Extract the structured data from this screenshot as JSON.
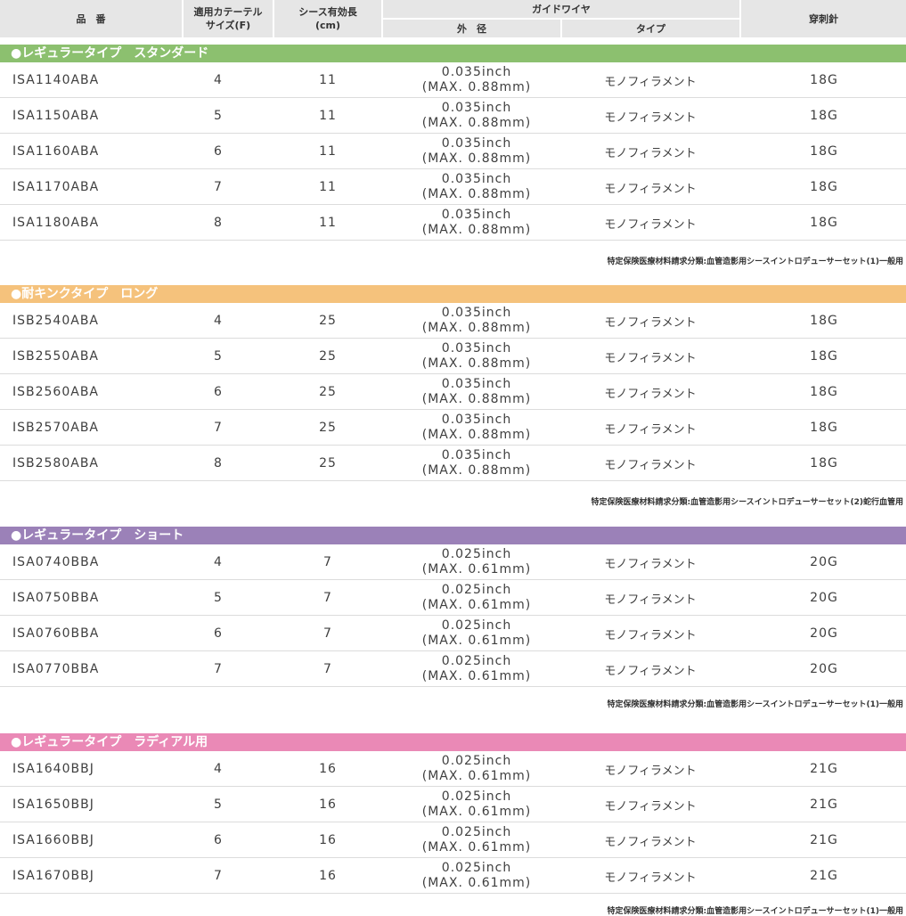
{
  "header": {
    "product_no": "品　番",
    "size_l1": "適用カテーテル",
    "size_l2": "サイズ(F)",
    "length_l1": "シース有効長",
    "length_l2": "(cm)",
    "guidewire": "ガイドワイヤ",
    "outer_diameter": "外　径",
    "type": "タイプ",
    "needle": "穿刺針"
  },
  "colors": {
    "header_bg": "#e6e6e6",
    "green": "#8cc06f",
    "orange": "#f5c27c",
    "purple": "#9b81b8",
    "pink": "#ea89b6",
    "divider": "#dcdcdc"
  },
  "sections": [
    {
      "label": "●レギュラータイプ　スタンダード",
      "color": "#8cc06f",
      "note": "特定保険医療材料請求分類:血管造影用シースイントロデューサーセット(1)一般用",
      "rows": [
        {
          "id": "ISA1140ABA",
          "size": "4",
          "length": "11",
          "od1": "0.035inch",
          "od2": "(MAX. 0.88mm)",
          "type": "モノフィラメント",
          "needle": "18G"
        },
        {
          "id": "ISA1150ABA",
          "size": "5",
          "length": "11",
          "od1": "0.035inch",
          "od2": "(MAX. 0.88mm)",
          "type": "モノフィラメント",
          "needle": "18G"
        },
        {
          "id": "ISA1160ABA",
          "size": "6",
          "length": "11",
          "od1": "0.035inch",
          "od2": "(MAX. 0.88mm)",
          "type": "モノフィラメント",
          "needle": "18G"
        },
        {
          "id": "ISA1170ABA",
          "size": "7",
          "length": "11",
          "od1": "0.035inch",
          "od2": "(MAX. 0.88mm)",
          "type": "モノフィラメント",
          "needle": "18G"
        },
        {
          "id": "ISA1180ABA",
          "size": "8",
          "length": "11",
          "od1": "0.035inch",
          "od2": "(MAX. 0.88mm)",
          "type": "モノフィラメント",
          "needle": "18G"
        }
      ]
    },
    {
      "label": "●耐キンクタイプ　ロング",
      "color": "#f5c27c",
      "note": "特定保険医療材料請求分類:血管造影用シースイントロデューサーセット(2)蛇行血管用",
      "rows": [
        {
          "id": "ISB2540ABA",
          "size": "4",
          "length": "25",
          "od1": "0.035inch",
          "od2": "(MAX. 0.88mm)",
          "type": "モノフィラメント",
          "needle": "18G"
        },
        {
          "id": "ISB2550ABA",
          "size": "5",
          "length": "25",
          "od1": "0.035inch",
          "od2": "(MAX. 0.88mm)",
          "type": "モノフィラメント",
          "needle": "18G"
        },
        {
          "id": "ISB2560ABA",
          "size": "6",
          "length": "25",
          "od1": "0.035inch",
          "od2": "(MAX. 0.88mm)",
          "type": "モノフィラメント",
          "needle": "18G"
        },
        {
          "id": "ISB2570ABA",
          "size": "7",
          "length": "25",
          "od1": "0.035inch",
          "od2": "(MAX. 0.88mm)",
          "type": "モノフィラメント",
          "needle": "18G"
        },
        {
          "id": "ISB2580ABA",
          "size": "8",
          "length": "25",
          "od1": "0.035inch",
          "od2": "(MAX. 0.88mm)",
          "type": "モノフィラメント",
          "needle": "18G"
        }
      ]
    },
    {
      "label": "●レギュラータイプ　ショート",
      "color": "#9b81b8",
      "note": "特定保険医療材料請求分類:血管造影用シースイントロデューサーセット(1)一般用",
      "rows": [
        {
          "id": "ISA0740BBA",
          "size": "4",
          "length": "7",
          "od1": "0.025inch",
          "od2": "(MAX. 0.61mm)",
          "type": "モノフィラメント",
          "needle": "20G"
        },
        {
          "id": "ISA0750BBA",
          "size": "5",
          "length": "7",
          "od1": "0.025inch",
          "od2": "(MAX. 0.61mm)",
          "type": "モノフィラメント",
          "needle": "20G"
        },
        {
          "id": "ISA0760BBA",
          "size": "6",
          "length": "7",
          "od1": "0.025inch",
          "od2": "(MAX. 0.61mm)",
          "type": "モノフィラメント",
          "needle": "20G"
        },
        {
          "id": "ISA0770BBA",
          "size": "7",
          "length": "7",
          "od1": "0.025inch",
          "od2": "(MAX. 0.61mm)",
          "type": "モノフィラメント",
          "needle": "20G"
        }
      ]
    },
    {
      "label": "●レギュラータイプ　ラディアル用",
      "color": "#ea89b6",
      "note": "特定保険医療材料請求分類:血管造影用シースイントロデューサーセット(1)一般用",
      "rows": [
        {
          "id": "ISA1640BBJ",
          "size": "4",
          "length": "16",
          "od1": "0.025inch",
          "od2": "(MAX. 0.61mm)",
          "type": "モノフィラメント",
          "needle": "21G"
        },
        {
          "id": "ISA1650BBJ",
          "size": "5",
          "length": "16",
          "od1": "0.025inch",
          "od2": "(MAX. 0.61mm)",
          "type": "モノフィラメント",
          "needle": "21G"
        },
        {
          "id": "ISA1660BBJ",
          "size": "6",
          "length": "16",
          "od1": "0.025inch",
          "od2": "(MAX. 0.61mm)",
          "type": "モノフィラメント",
          "needle": "21G"
        },
        {
          "id": "ISA1670BBJ",
          "size": "7",
          "length": "16",
          "od1": "0.025inch",
          "od2": "(MAX. 0.61mm)",
          "type": "モノフィラメント",
          "needle": "21G"
        }
      ]
    }
  ]
}
